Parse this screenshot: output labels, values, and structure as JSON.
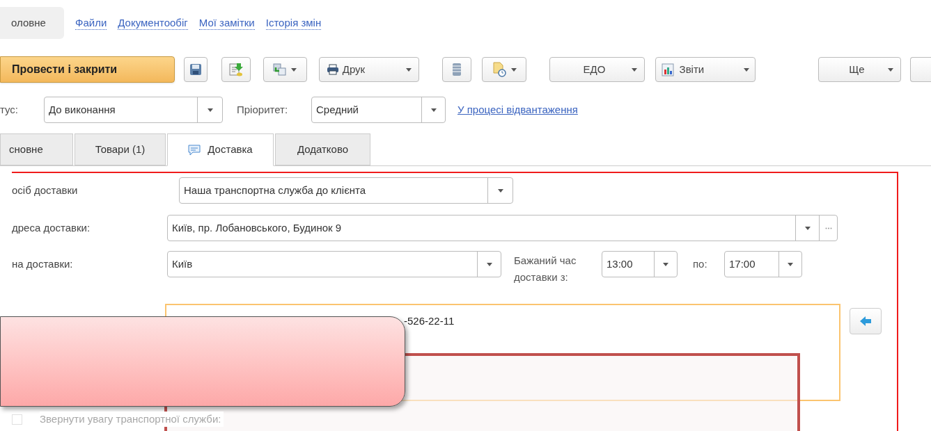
{
  "nav_tabs": [
    {
      "label": "оловне",
      "selected": true
    },
    {
      "label": "Файли",
      "selected": false
    },
    {
      "label": "Документообіг",
      "selected": false
    },
    {
      "label": "Мої замітки",
      "selected": false
    },
    {
      "label": "Історія змін",
      "selected": false
    }
  ],
  "toolbar": {
    "primary": "Провести і закрити",
    "print": "Друк",
    "edo": "ЕДО",
    "reports": "Звіти",
    "more": "Ще"
  },
  "status_row": {
    "status_label": "тус:",
    "status": "До виконання",
    "priority_label": "Пріоритет:",
    "priority": "Средний",
    "link": "У процесі відвантаження"
  },
  "form_tabs": [
    {
      "label": "сновне",
      "selected": false
    },
    {
      "label": "Товари (1)",
      "selected": false
    },
    {
      "label": "Доставка",
      "selected": true
    },
    {
      "label": "Додатково",
      "selected": false
    }
  ],
  "delivery": {
    "method_label": "осіб доставки",
    "method": "Наша транспортна служба до клієнта",
    "address_label": "дреса доставки:",
    "address": "Київ, пр. Лобановського, Будинок 9",
    "zone_label": "на доставки:",
    "zone": "Київ",
    "time_label": "Бажаний час доставки з:",
    "time_from": "13:00",
    "to_label": "по:",
    "time_to": "17:00",
    "contact": "-526-22-11",
    "attention": {
      "label": "Звернути увагу транспортної служби:",
      "checked": false
    }
  }
}
